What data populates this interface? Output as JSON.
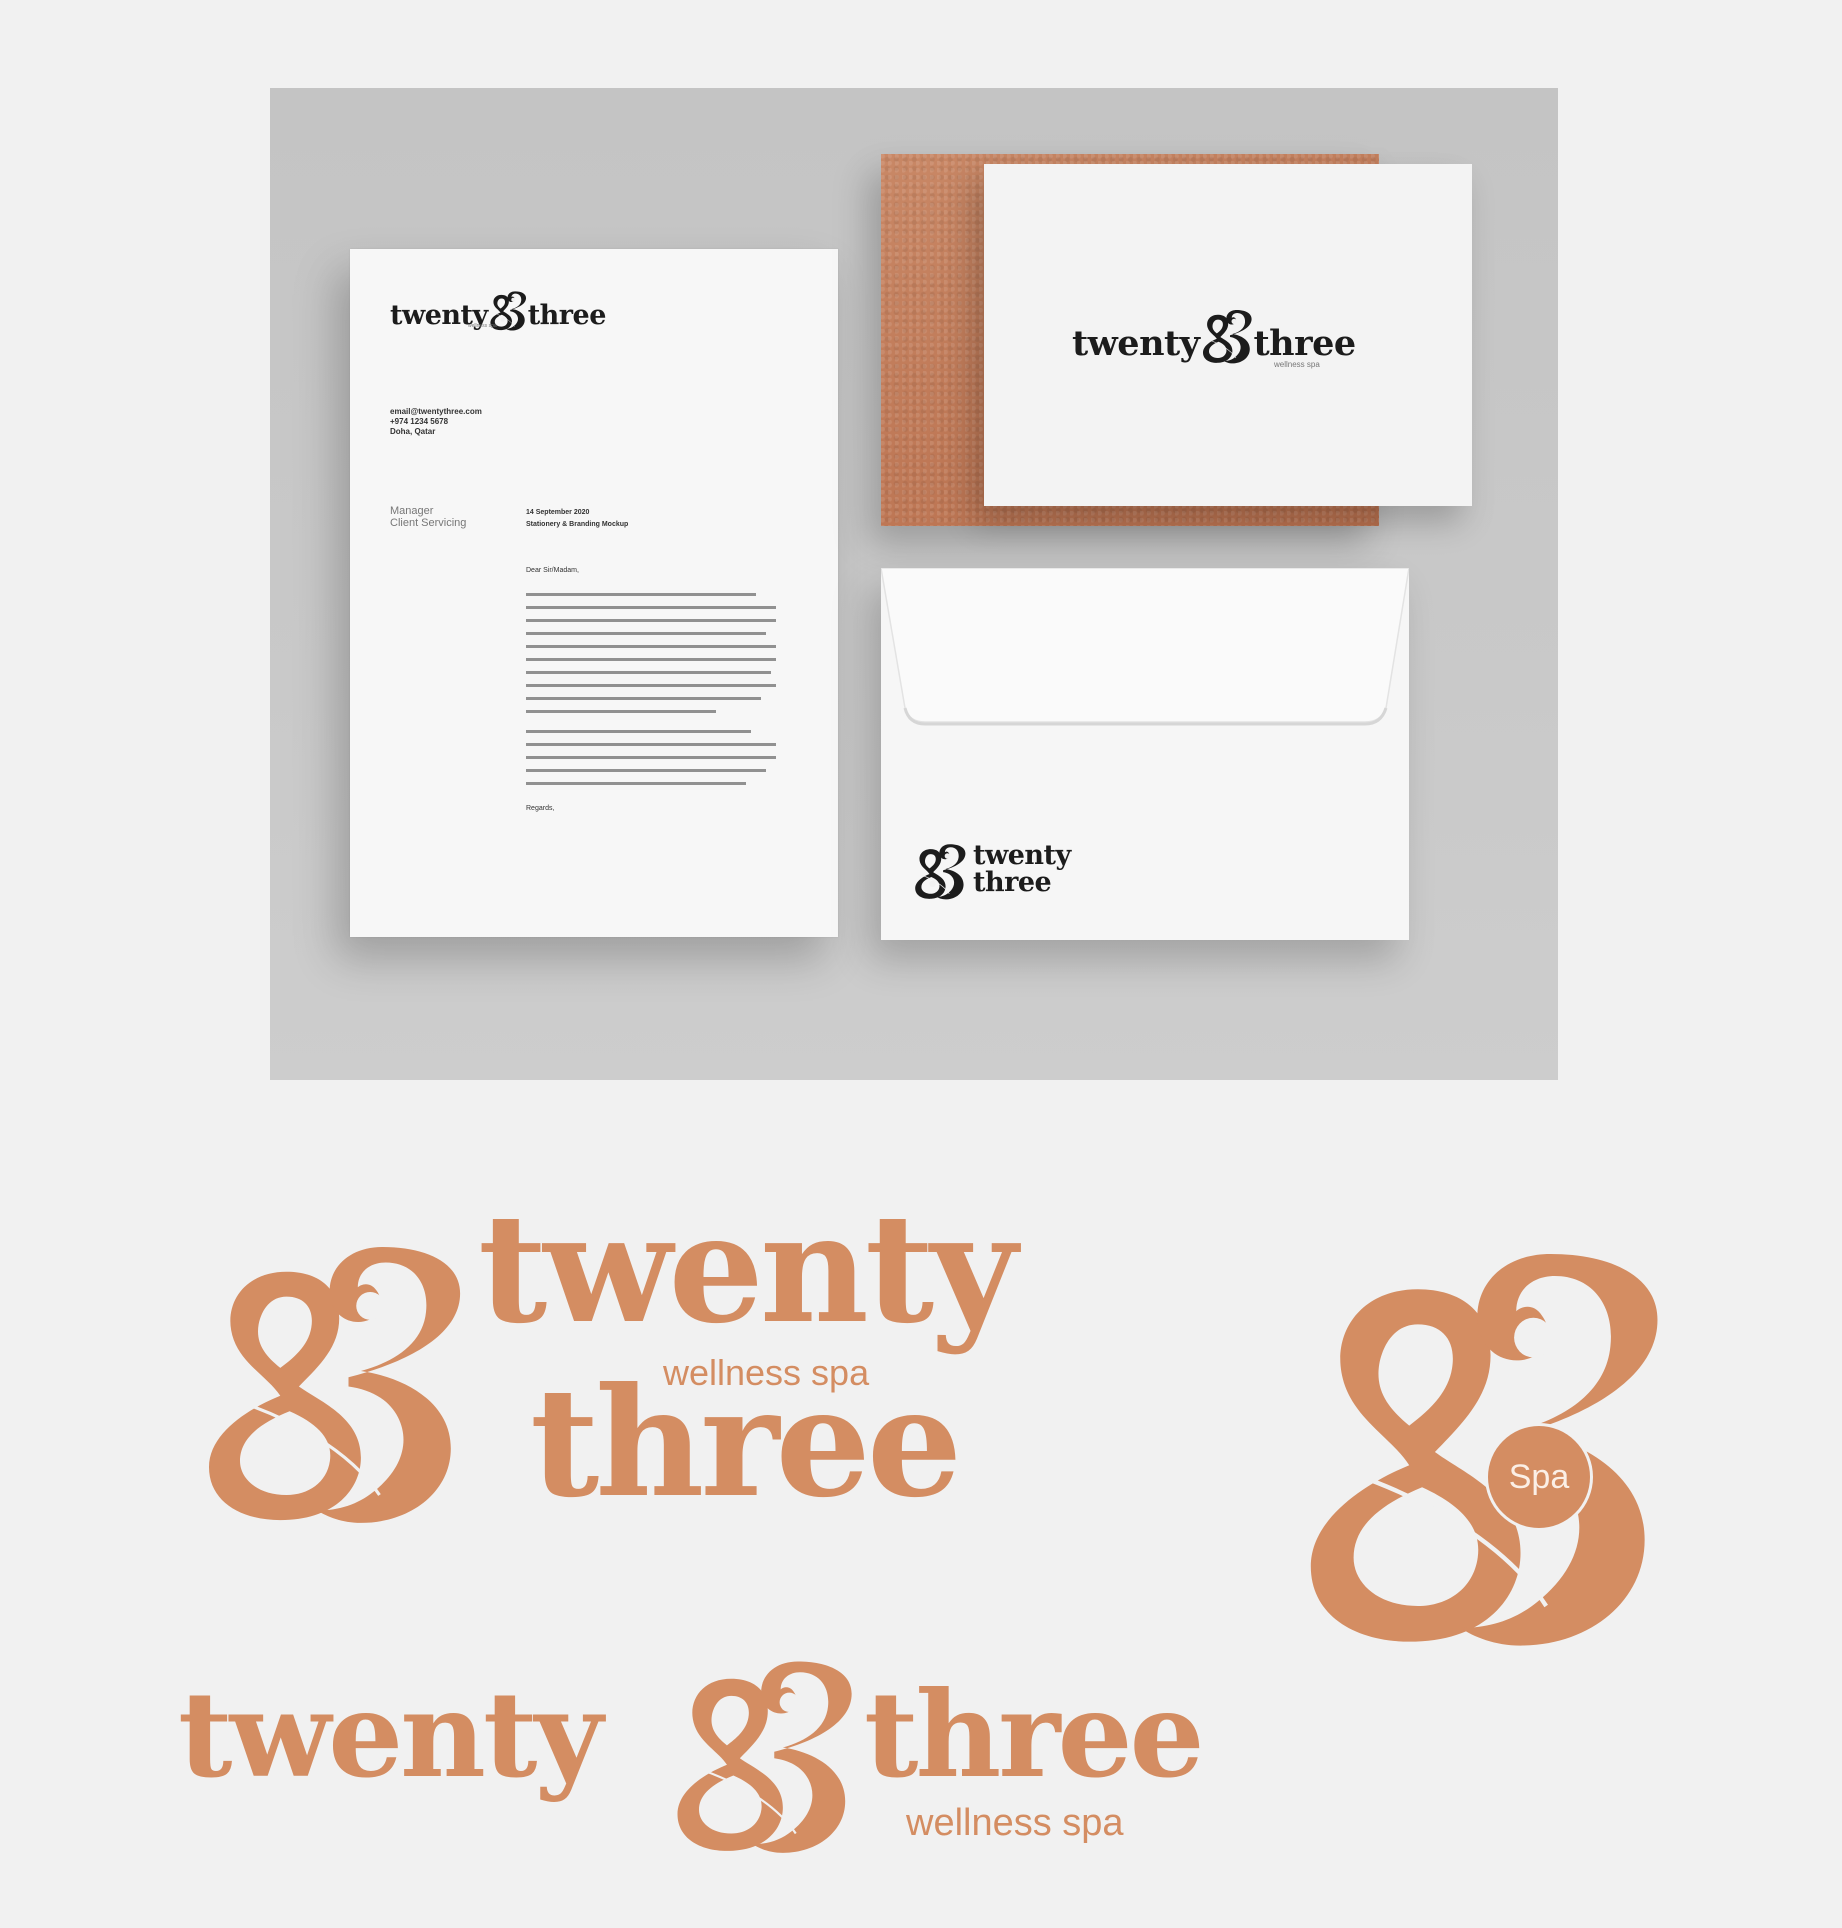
{
  "brand": {
    "word1": "twenty",
    "word2": "three",
    "tagline": "wellness spa",
    "badge": "Spa",
    "accent_color": "#d48d62",
    "ink_color": "#1c1c1c"
  },
  "letterhead": {
    "address": [
      "email@twentythree.com",
      "+974 1234 5678",
      "Doha, Qatar"
    ],
    "recipient_title": "Manager",
    "recipient_dept": "Client Servicing",
    "date": "14 September 2020",
    "subject": "Stationery & Branding Mockup",
    "salutation": "Dear Sir/Madam,",
    "closing": "Regards,"
  },
  "icons": [
    "ampersand-23-monogram-icon"
  ]
}
